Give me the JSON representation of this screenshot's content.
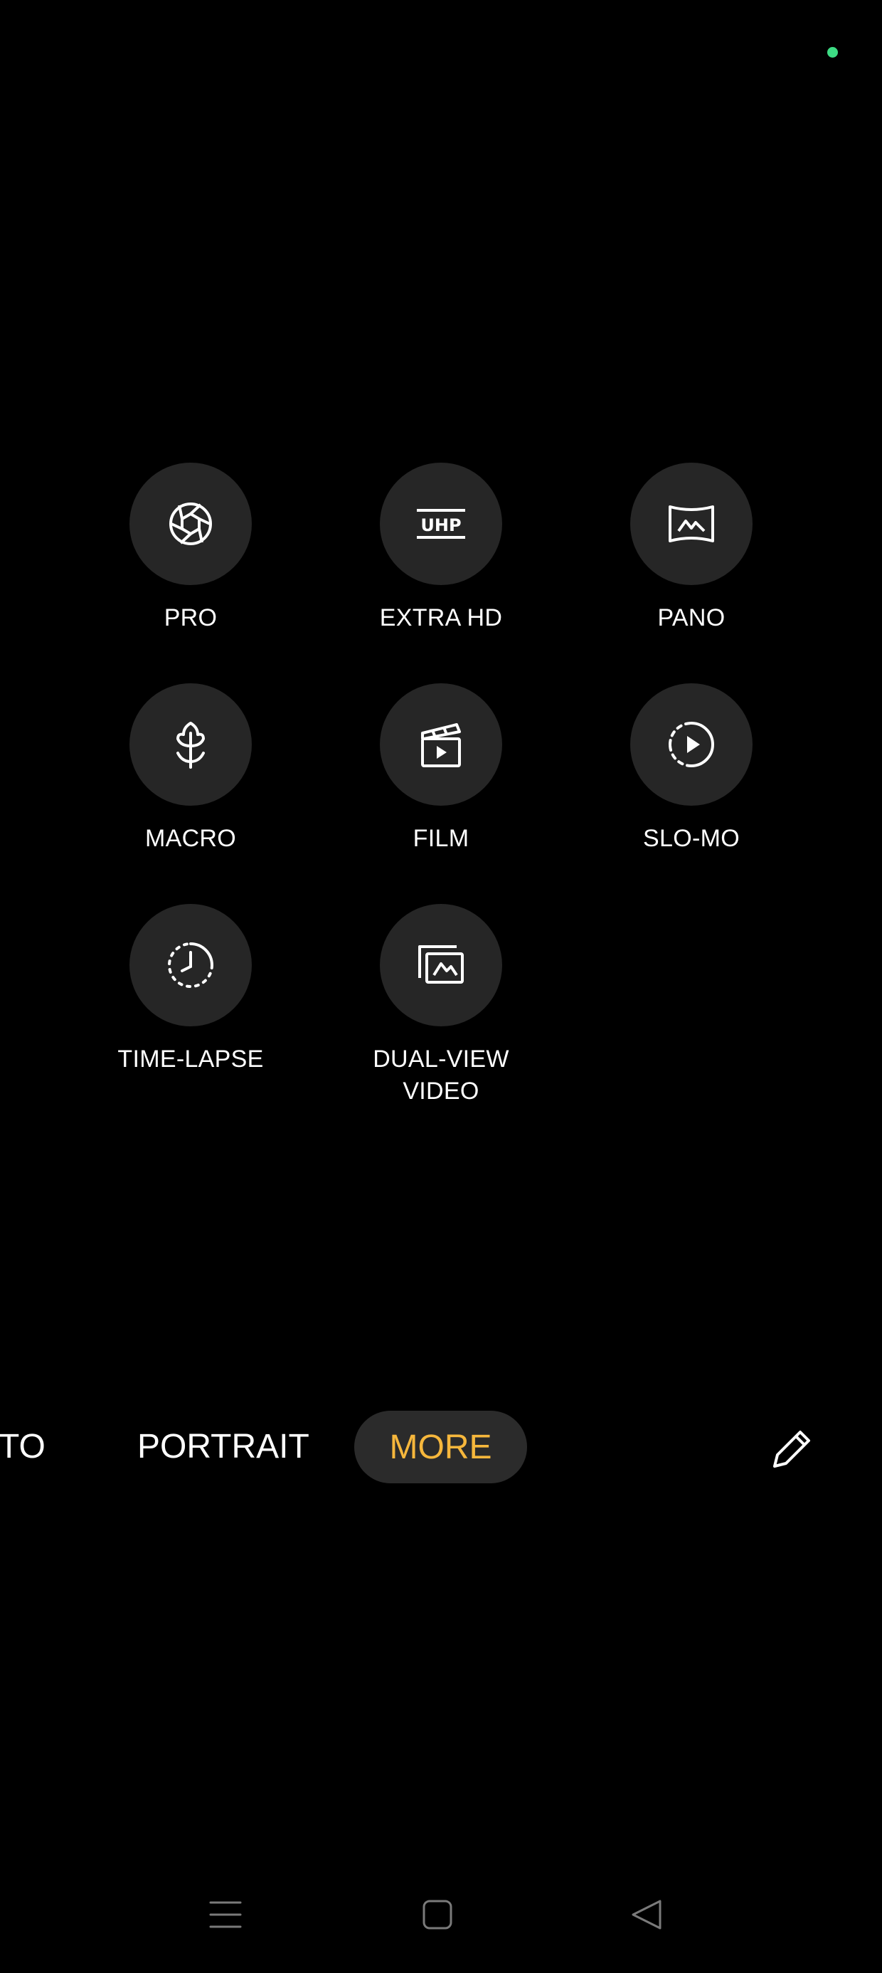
{
  "status": {
    "indicator_color": "#3ddc84"
  },
  "modes": [
    {
      "label": "PRO",
      "icon": "aperture-icon"
    },
    {
      "label": "EXTRA HD",
      "icon": "uhp-icon"
    },
    {
      "label": "PANO",
      "icon": "panorama-icon"
    },
    {
      "label": "MACRO",
      "icon": "flower-icon"
    },
    {
      "label": "FILM",
      "icon": "clapperboard-icon"
    },
    {
      "label": "SLO-MO",
      "icon": "slow-motion-icon"
    },
    {
      "label": "TIME-LAPSE",
      "icon": "timelapse-icon"
    },
    {
      "label": "DUAL-VIEW\nVIDEO",
      "icon": "dual-view-icon"
    }
  ],
  "uhp_icon_text": "UHP",
  "mode_bar": {
    "photo_partial": "TO",
    "portrait": "PORTRAIT",
    "more": "MORE",
    "edit_icon": "pencil-icon"
  },
  "nav_bar": {
    "menu_icon": "menu-icon",
    "home_icon": "home-icon",
    "back_icon": "back-icon"
  },
  "colors": {
    "accent": "#f6b73c",
    "tile": "#262626",
    "pill": "#2b2b2b",
    "text": "#ffffff",
    "nav": "#7a7a7a"
  }
}
